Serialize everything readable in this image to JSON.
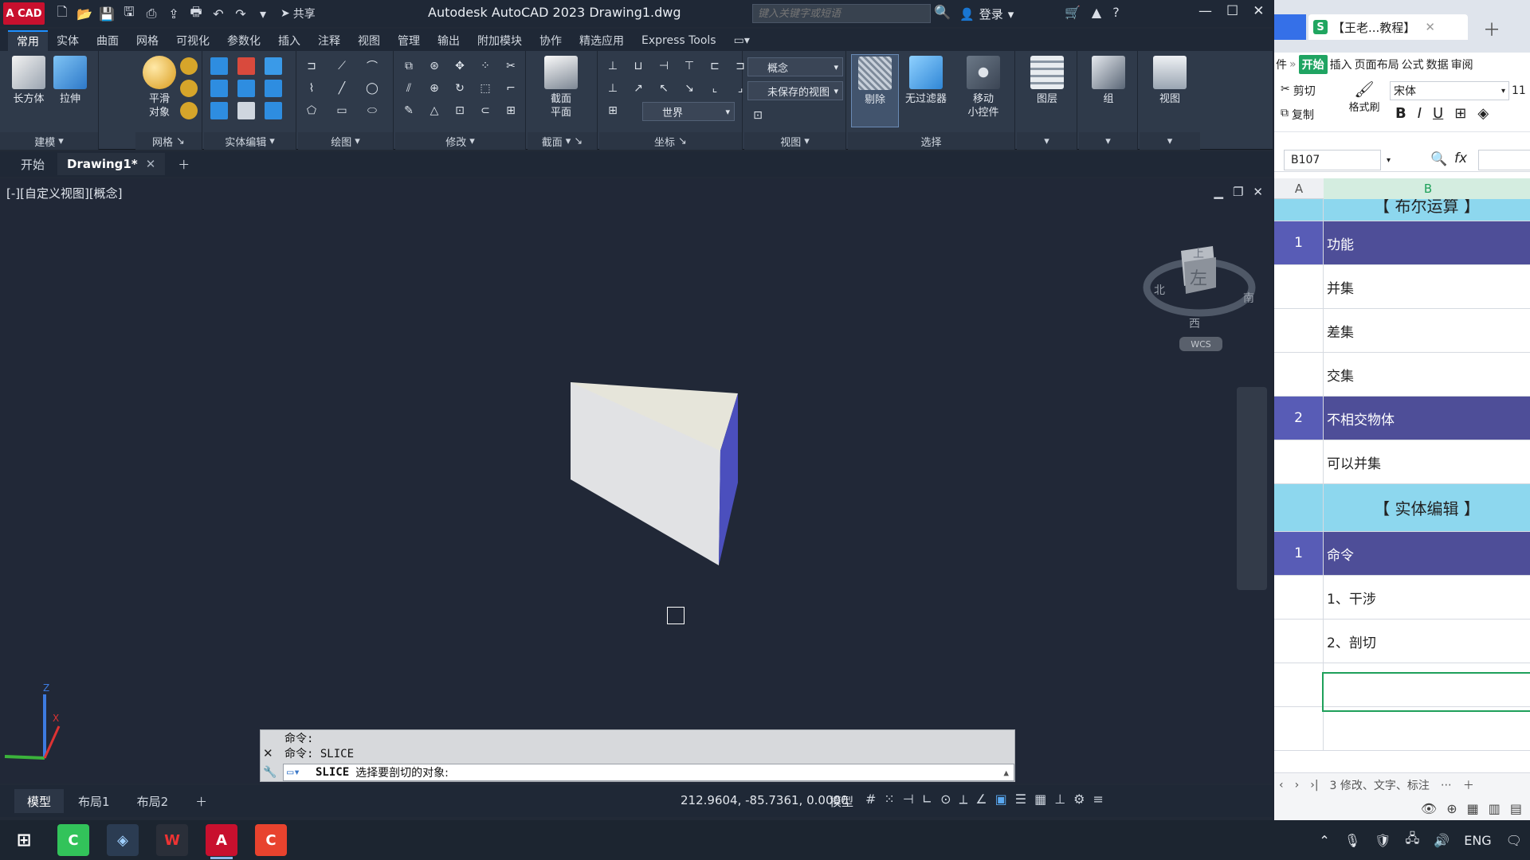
{
  "acad": {
    "logo": "A CAD",
    "share_label": "共享",
    "title": "Autodesk AutoCAD 2023    Drawing1.dwg",
    "search_placeholder": "键入关键字或短语",
    "login_label": "登录",
    "menu_tabs": [
      "常用",
      "实体",
      "曲面",
      "网格",
      "可视化",
      "参数化",
      "插入",
      "注释",
      "视图",
      "管理",
      "输出",
      "附加模块",
      "协作",
      "精选应用",
      "Express Tools"
    ],
    "panels": {
      "modeling": {
        "title": "建模",
        "buttons": [
          "长方体",
          "拉伸"
        ]
      },
      "mesh": {
        "title": "网格",
        "buttons": [
          "平滑\n对象"
        ]
      },
      "solid_edit": {
        "title": "实体编辑"
      },
      "draw": {
        "title": "绘图"
      },
      "modify": {
        "title": "修改"
      },
      "section": {
        "title": "截面",
        "buttons": [
          "截面\n平面"
        ]
      },
      "coordinates": {
        "title": "坐标",
        "ucs_value": "世界"
      },
      "view": {
        "title": "视图",
        "visual_style": "概念",
        "named_view": "未保存的视图"
      },
      "selection": {
        "title": "选择",
        "buttons": [
          "剔除",
          "无过滤器",
          "移动\n小控件"
        ]
      },
      "layers": {
        "buttons": [
          "图层"
        ]
      },
      "groups": {
        "buttons": [
          "组"
        ]
      },
      "views": {
        "buttons": [
          "视图"
        ]
      }
    },
    "file_tabs": {
      "start": "开始",
      "drawing": "Drawing1*"
    },
    "viewport_label": "[-][自定义视图][概念]",
    "viewcube": {
      "face": "左",
      "north": "上",
      "south": "西",
      "east": "南",
      "west": "北",
      "wcs": "WCS"
    },
    "command": {
      "history": [
        "命令:",
        "命令:  SLICE"
      ],
      "current_cmd": "SLICE",
      "prompt": "选择要剖切的对象:"
    },
    "layout_tabs": [
      "模型",
      "布局1",
      "布局2"
    ],
    "coordinates": "212.9604, -85.7361, 0.0000",
    "status_model": "模型"
  },
  "wps": {
    "tab_title": "【王老...教程】",
    "menu": [
      "件",
      "»",
      "开始",
      "插入",
      "页面布局",
      "公式",
      "数据",
      "审阅"
    ],
    "clipboard": {
      "cut": "剪切",
      "copy": "复制",
      "format_painter": "格式刷"
    },
    "font_name": "宋体",
    "font_size": "11",
    "name_box": "B107",
    "fx": "fx",
    "col_headers": [
      "A",
      "B"
    ],
    "rows": [
      {
        "type": "sec",
        "a": "",
        "b": "【 布尔运算 】"
      },
      {
        "type": "hdr",
        "a": "1",
        "b": "功能"
      },
      {
        "type": "item",
        "a": "",
        "b": "并集"
      },
      {
        "type": "item",
        "a": "",
        "b": "差集"
      },
      {
        "type": "item",
        "a": "",
        "b": "交集"
      },
      {
        "type": "hdr",
        "a": "2",
        "b": "不相交物体"
      },
      {
        "type": "item",
        "a": "",
        "b": "可以并集"
      },
      {
        "type": "sec",
        "a": "",
        "b": "【 实体编辑 】"
      },
      {
        "type": "hdr",
        "a": "1",
        "b": "命令"
      },
      {
        "type": "item",
        "a": "",
        "b": "1、干涉"
      },
      {
        "type": "item",
        "a": "",
        "b": "2、剖切"
      },
      {
        "type": "item",
        "a": "",
        "b": ""
      },
      {
        "type": "item",
        "a": "",
        "b": ""
      }
    ],
    "sheet_tab": "3 修改、文字、标注"
  },
  "taskbar": {
    "lang": "ENG"
  },
  "colors": {
    "accent": "#1e8fff",
    "wps_green": "#1fa462",
    "header_purple": "#4e4e98",
    "section_cyan": "#8dd7ee"
  }
}
